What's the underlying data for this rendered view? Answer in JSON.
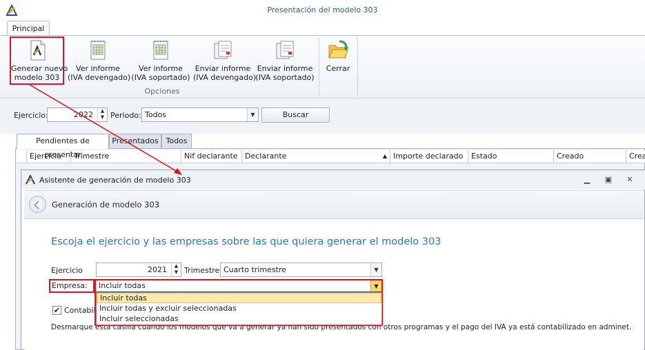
{
  "window": {
    "title": "Presentación del modelo 303"
  },
  "ribbon": {
    "tab": "Principal",
    "group_label": "Opciones",
    "buttons": {
      "generar": [
        "Generar nuevo",
        "modelo 303"
      ],
      "ver_dev": [
        "Ver informe",
        "(IVA devengado)"
      ],
      "ver_sop": [
        "Ver informe",
        "(IVA soportado)"
      ],
      "env_dev": [
        "Enviar informe",
        "(IVA devengado)"
      ],
      "env_sop": [
        "Enviar informe",
        "(IVA soportado)"
      ],
      "cerrar": [
        "Cerrar"
      ]
    }
  },
  "filters": {
    "ejercicio_label": "Ejercicio:",
    "ejercicio_value": "2022",
    "periodo_label": "Periodo:",
    "periodo_value": "Todos",
    "buscar": "Buscar"
  },
  "tabs": [
    "Pendientes de presentar",
    "Presentados",
    "Todos"
  ],
  "grid": {
    "columns": [
      "Ejercicio",
      "Trimestre",
      "Nif declarante",
      "Declarante",
      "Importe declarado",
      "Estado",
      "Creado",
      "Crea"
    ]
  },
  "dialog": {
    "title": "Asistente de generación de modelo 303",
    "header": "Generación de modelo 303",
    "instruction": "Escoja el ejercicio y las empresas sobre las que quiera generar el modelo 303",
    "ejercicio_label": "Ejercicio",
    "ejercicio_value": "2021",
    "trimestre_label": "Trimestre:",
    "trimestre_value": "Cuarto trimestre",
    "empresa_label": "Empresa:",
    "empresa_value": "Incluir todas",
    "empresa_options": [
      "Incluir todas",
      "Incluir todas y excluir seleccionadas",
      "Incluir seleccionadas"
    ],
    "checkbox_label_visible": "Contabiliz",
    "hint": "Desmarque esta casilla cuando los modelos que va a generar ya han sido presentados con otros programas y el pago del IVA ya está contabilizado en adminet."
  },
  "colors": {
    "accent_red": "#e0141e",
    "link_blue": "#2e75b6",
    "title_blue": "#2e5d8a",
    "highlight": "#ffe9a8"
  },
  "icons": [
    "app-icon",
    "tax-model-icon",
    "report-icon",
    "send-report-icon",
    "folder-exit-icon",
    "back-arrow-icon",
    "minimize-icon",
    "restore-icon",
    "close-icon",
    "checkmark-icon",
    "dropdown-arrow-icon",
    "spin-arrows-icon"
  ]
}
